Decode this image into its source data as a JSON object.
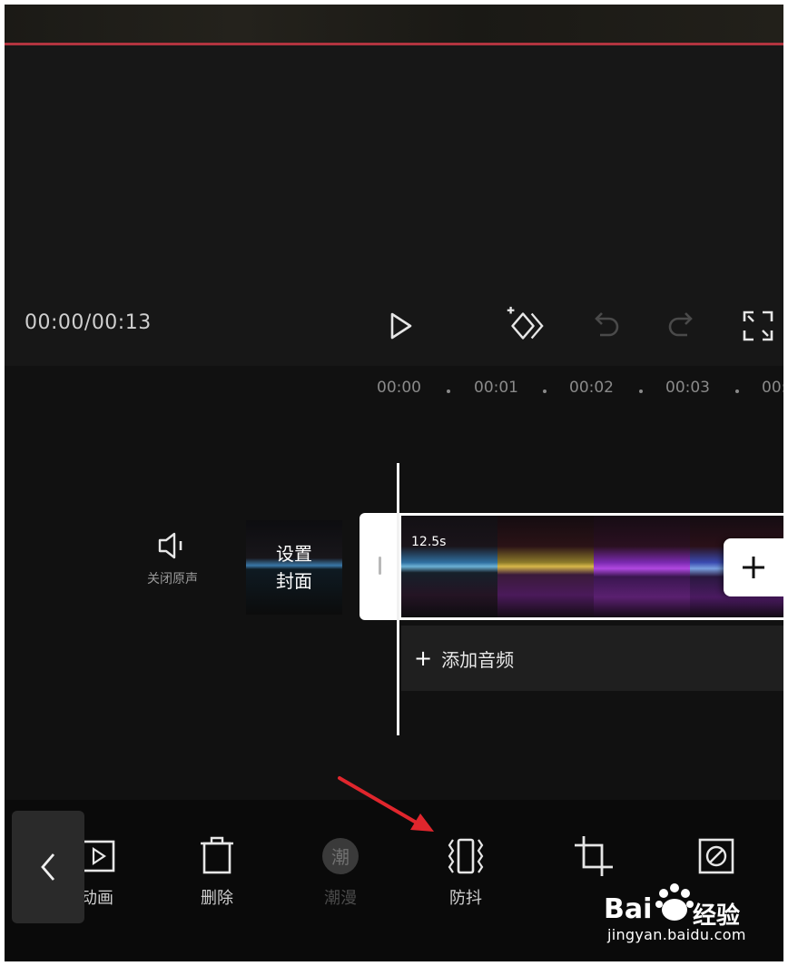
{
  "player": {
    "time_readout": "00:00/00:13",
    "play_icon": "play-icon",
    "keyframe_icon": "keyframe-add-icon",
    "undo_icon": "undo-icon",
    "redo_icon": "redo-icon",
    "fullscreen_icon": "fullscreen-icon"
  },
  "ruler": {
    "ticks": [
      "00:00",
      "00:01",
      "00:02",
      "00:03",
      "00:"
    ]
  },
  "track": {
    "mute_label": "关闭原声",
    "cover_line1": "设置",
    "cover_line2": "封面",
    "clip_duration": "12.5s",
    "add_clip_symbol": "+",
    "add_audio_symbol": "+",
    "add_audio_label": "添加音频"
  },
  "toolbar": {
    "back_icon": "chevron-left-icon",
    "tools": [
      {
        "label": "动画",
        "icon": "animation-icon",
        "enabled": true
      },
      {
        "label": "删除",
        "icon": "delete-icon",
        "enabled": true
      },
      {
        "label": "潮漫",
        "icon": "trend-icon",
        "enabled": false,
        "icon_text": "潮"
      },
      {
        "label": "防抖",
        "icon": "stabilize-icon",
        "enabled": true
      },
      {
        "label": "",
        "icon": "crop-icon",
        "enabled": true
      },
      {
        "label": "",
        "icon": "no-symbol-icon",
        "enabled": true
      }
    ]
  },
  "annotation": {
    "arrow_color": "#e0262d"
  },
  "watermark": {
    "brand": "Bai",
    "brand_cn": "经验",
    "url": "jingyan.baidu.com"
  },
  "colors": {
    "accent_red": "#b2343f",
    "background": "#161616"
  }
}
